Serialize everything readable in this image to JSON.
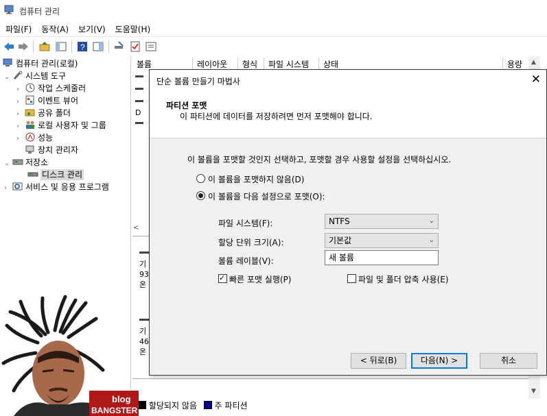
{
  "window": {
    "title": "컴퓨터 관리"
  },
  "menu": [
    "파일(F)",
    "동작(A)",
    "보기(V)",
    "도움말(H)"
  ],
  "tree": {
    "root": "컴퓨터 관리(로컬)",
    "system_tools": "시스템 도구",
    "task_scheduler": "작업 스케줄러",
    "event_viewer": "이벤트 뷰어",
    "shared_folders": "공유 폴더",
    "local_users": "로컬 사용자 및 그룹",
    "performance": "성능",
    "device_manager": "장치 관리자",
    "storage": "저장소",
    "disk_management": "디스크 관리",
    "services": "서비스 및 응용 프로그램"
  },
  "columns": [
    "볼륨",
    "레이아웃",
    "형식",
    "파일 시스템",
    "상태",
    "용량"
  ],
  "background_fragments": {
    "row_d": "D",
    "disk1_line1": "기",
    "disk1_line2": "93",
    "disk1_line3": "온",
    "disk2_line1": "기",
    "disk2_line2": "46",
    "disk2_line3": "온"
  },
  "dialog": {
    "title": "단순 볼륨 만들기 마법사",
    "header_title": "파티션 포맷",
    "header_subtitle": "이 파티션에 데이터를 저장하려면 먼저 포맷해야 합니다.",
    "instruction": "이 볼륨을 포맷할 것인지 선택하고, 포맷할 경우 사용할 설정을 선택하십시오.",
    "radio_no_format": "이 볼륨을 포맷하지 않음(D)",
    "radio_format": "이 볼륨을 다음 설정으로 포맷(O):",
    "fs_label": "파일 시스템(F):",
    "fs_value": "NTFS",
    "alloc_label": "할당 단위 크기(A):",
    "alloc_value": "기본값",
    "volume_label_label": "볼륨 레이블(V):",
    "volume_label_value": "새 볼륨",
    "quick_format": "빠른 포맷 실행(P)",
    "compression": "파일 및 폴더 압축 사용(E)",
    "back_btn": "< 뒤로(B)",
    "next_btn": "다음(N) >",
    "cancel_btn": "취소"
  },
  "legend": {
    "unallocated": "할당되지 않음",
    "primary": "주 파티션"
  },
  "watermark": {
    "top": "blog",
    "bottom": "BANGSTER"
  },
  "colors": {
    "primary_partition": "#00008b",
    "accent": "#0078d7"
  }
}
